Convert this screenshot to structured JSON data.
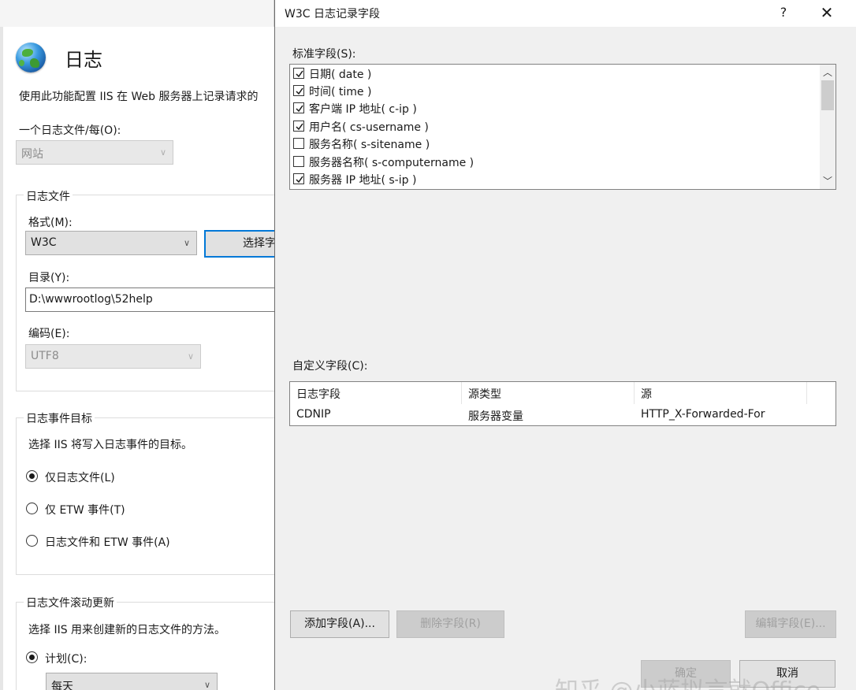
{
  "background_pane": {
    "title": "日志",
    "description": "使用此功能配置 IIS 在 Web 服务器上记录请求的",
    "one_log_file_per_label": "一个日志文件/每(O):",
    "one_log_file_per_value": "网站",
    "log_file_group": {
      "title": "日志文件",
      "format_label": "格式(M):",
      "format_value": "W3C",
      "select_fields_button": "选择字",
      "directory_label": "目录(Y):",
      "directory_value": "D:\\wwwrootlog\\52help",
      "encoding_label": "编码(E):",
      "encoding_value": "UTF8"
    },
    "event_destination_group": {
      "title": "日志事件目标",
      "description": "选择 IIS 将写入日志事件的目标。",
      "options": [
        {
          "label": "仅日志文件(L)",
          "selected": true
        },
        {
          "label": "仅 ETW 事件(T)",
          "selected": false
        },
        {
          "label": "日志文件和 ETW 事件(A)",
          "selected": false
        }
      ]
    },
    "rollover_group": {
      "title": "日志文件滚动更新",
      "description": "选择 IIS 用来创建新的日志文件的方法。",
      "schedule_label": "计划(C):",
      "schedule_value": "每天"
    }
  },
  "dialog": {
    "title": "W3C 日志记录字段",
    "help_label": "?",
    "close_label": "✕",
    "standard_fields_label": "标准字段(S):",
    "standard_fields": [
      {
        "label": "日期( date )",
        "checked": true
      },
      {
        "label": "时间( time )",
        "checked": true
      },
      {
        "label": "客户端 IP 地址( c-ip )",
        "checked": true
      },
      {
        "label": "用户名( cs-username )",
        "checked": true
      },
      {
        "label": "服务名称( s-sitename )",
        "checked": false
      },
      {
        "label": "服务器名称( s-computername )",
        "checked": false
      },
      {
        "label": "服务器 IP 地址( s-ip )",
        "checked": true
      }
    ],
    "custom_fields_label": "自定义字段(C):",
    "custom_columns": [
      "日志字段",
      "源类型",
      "源"
    ],
    "custom_rows": [
      [
        "CDNIP",
        "服务器变量",
        "HTTP_X-Forwarded-For"
      ]
    ],
    "add_field_button": "添加字段(A)...",
    "remove_field_button": "删除字段(R)",
    "edit_field_button": "编辑字段(E)...",
    "ok_button": "确定",
    "cancel_button": "取消"
  },
  "watermark": "知乎 @小蓝拟言就Office"
}
